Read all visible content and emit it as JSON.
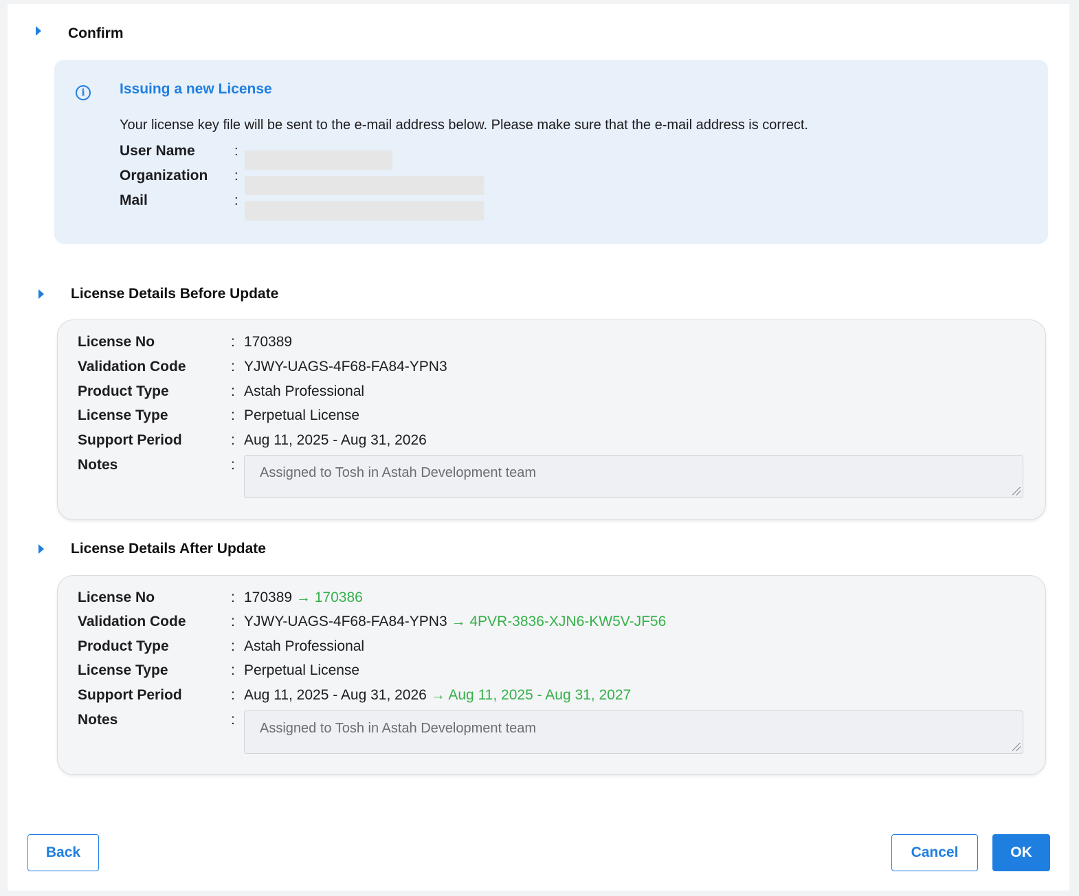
{
  "confirm": {
    "title": "Confirm",
    "info": {
      "title": "Issuing a new License",
      "icon": "info-icon",
      "message": "Your license key file will be sent to the e-mail address below. Please make sure that the e-mail address is correct.",
      "fields": [
        {
          "label": "User Name",
          "colon": ":"
        },
        {
          "label": "Organization",
          "colon": ":"
        },
        {
          "label": "Mail",
          "colon": ":"
        }
      ]
    }
  },
  "before": {
    "title": "License Details Before Update",
    "rows": [
      {
        "label": "License No",
        "colon": ":",
        "value": "170389"
      },
      {
        "label": "Validation Code",
        "colon": ":",
        "value": "YJWY-UAGS-4F68-FA84-YPN3"
      },
      {
        "label": "Product Type",
        "colon": ":",
        "value": "Astah Professional"
      },
      {
        "label": "License Type",
        "colon": ":",
        "value": "Perpetual License"
      },
      {
        "label": "Support Period",
        "colon": ":",
        "value": "Aug 11, 2025 - Aug 31, 2026"
      }
    ],
    "notes_label": "Notes",
    "notes_colon": ":",
    "notes_value": "Assigned to Tosh in Astah Development team"
  },
  "after": {
    "title": "License Details After Update",
    "rows": [
      {
        "label": "License No",
        "colon": ":",
        "value": "170389",
        "new": "→ 170386"
      },
      {
        "label": "Validation Code",
        "colon": ":",
        "value": "YJWY-UAGS-4F68-FA84-YPN3",
        "new": "→ 4PVR-3836-XJN6-KW5V-JF56"
      },
      {
        "label": "Product Type",
        "colon": ":",
        "value": "Astah Professional"
      },
      {
        "label": "License Type",
        "colon": ":",
        "value": "Perpetual License"
      },
      {
        "label": "Support Period",
        "colon": ":",
        "value": "Aug 11, 2025 - Aug 31, 2026",
        "new": "→ Aug 11, 2025 - Aug 31, 2027"
      }
    ],
    "notes_label": "Notes",
    "notes_colon": ":",
    "notes_value": "Assigned to Tosh in Astah Development team"
  },
  "buttons": {
    "back": "Back",
    "cancel": "Cancel",
    "ok": "OK"
  },
  "colors": {
    "accent": "#1f7fe0",
    "new_value": "#35b04a",
    "info_bg": "#e8f0fa"
  }
}
